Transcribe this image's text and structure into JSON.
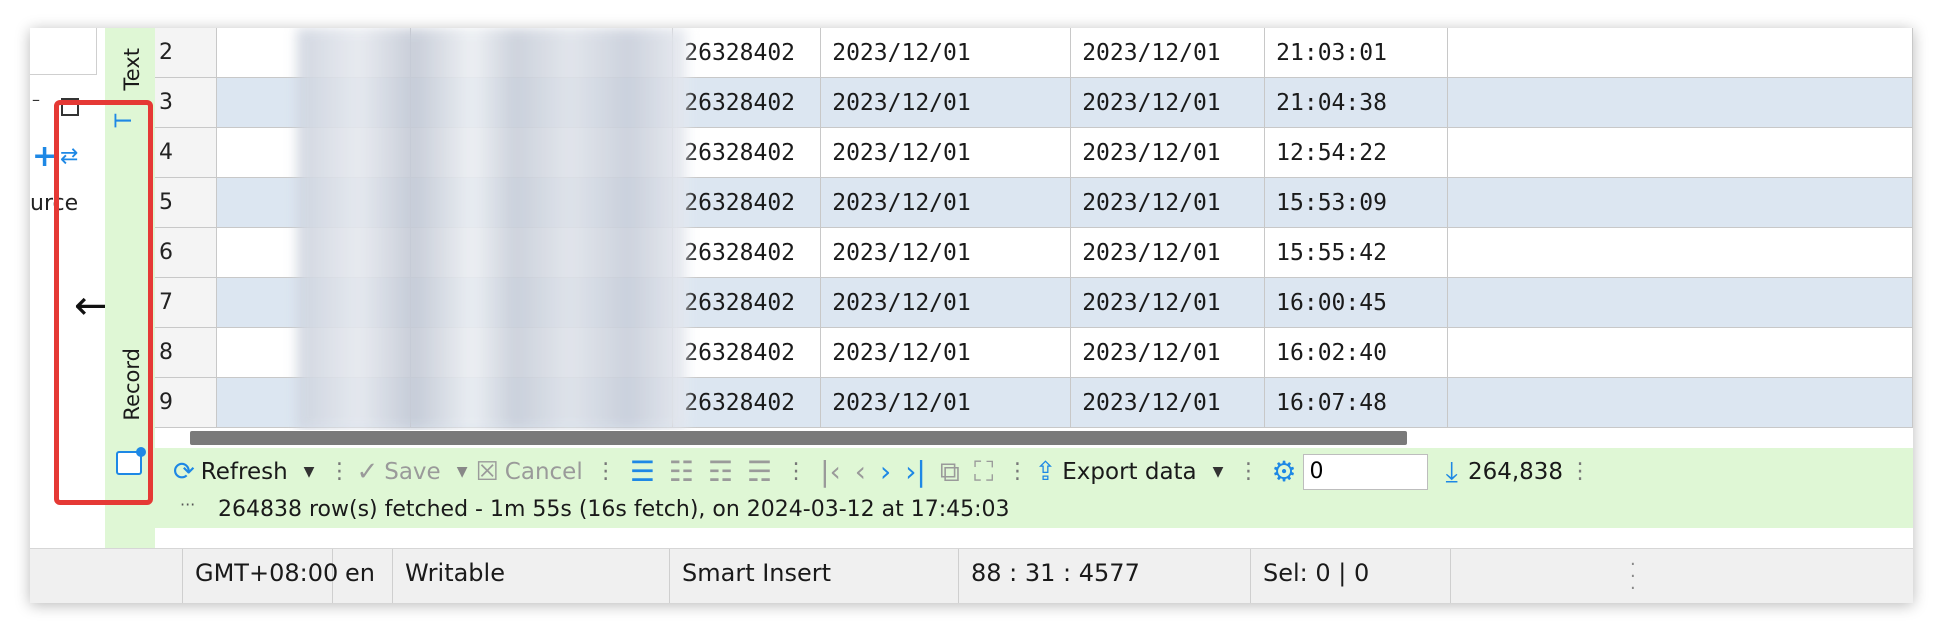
{
  "left_panel": {
    "label": "urce"
  },
  "side_tabs": {
    "text_label": "Text",
    "record_label": "Record"
  },
  "grid": {
    "rows": [
      {
        "num": "2",
        "id": "26328402",
        "date1": "2023/12/01",
        "date2": "2023/12/01",
        "time": "21:03:01"
      },
      {
        "num": "3",
        "id": "26328402",
        "date1": "2023/12/01",
        "date2": "2023/12/01",
        "time": "21:04:38"
      },
      {
        "num": "4",
        "id": "26328402",
        "date1": "2023/12/01",
        "date2": "2023/12/01",
        "time": "12:54:22"
      },
      {
        "num": "5",
        "id": "26328402",
        "date1": "2023/12/01",
        "date2": "2023/12/01",
        "time": "15:53:09"
      },
      {
        "num": "6",
        "id": "26328402",
        "date1": "2023/12/01",
        "date2": "2023/12/01",
        "time": "15:55:42"
      },
      {
        "num": "7",
        "id": "26328402",
        "date1": "2023/12/01",
        "date2": "2023/12/01",
        "time": "16:00:45"
      },
      {
        "num": "8",
        "id": "26328402",
        "date1": "2023/12/01",
        "date2": "2023/12/01",
        "time": "16:02:40"
      },
      {
        "num": "9",
        "id": "26328402",
        "date1": "2023/12/01",
        "date2": "2023/12/01",
        "time": "16:07:48"
      }
    ]
  },
  "toolbar": {
    "refresh": "Refresh",
    "save": "Save",
    "cancel": "Cancel",
    "export": "Export data",
    "fetch_size": "0",
    "row_count": "264,838"
  },
  "status": {
    "fetch_message": "264838 row(s) fetched - 1m 55s (16s fetch), on 2024-03-12 at 17:45:03",
    "timezone": "GMT+08:00",
    "locale": "en",
    "mode": "Writable",
    "insert_mode": "Smart Insert",
    "position": "88 : 31 : 4577",
    "selection": "Sel: 0 | 0"
  },
  "colors": {
    "panel_green": "#dff7d5",
    "row_alt_blue": "#dce6f1",
    "icon_blue": "#1e88e5",
    "highlight_red": "#e53935"
  }
}
